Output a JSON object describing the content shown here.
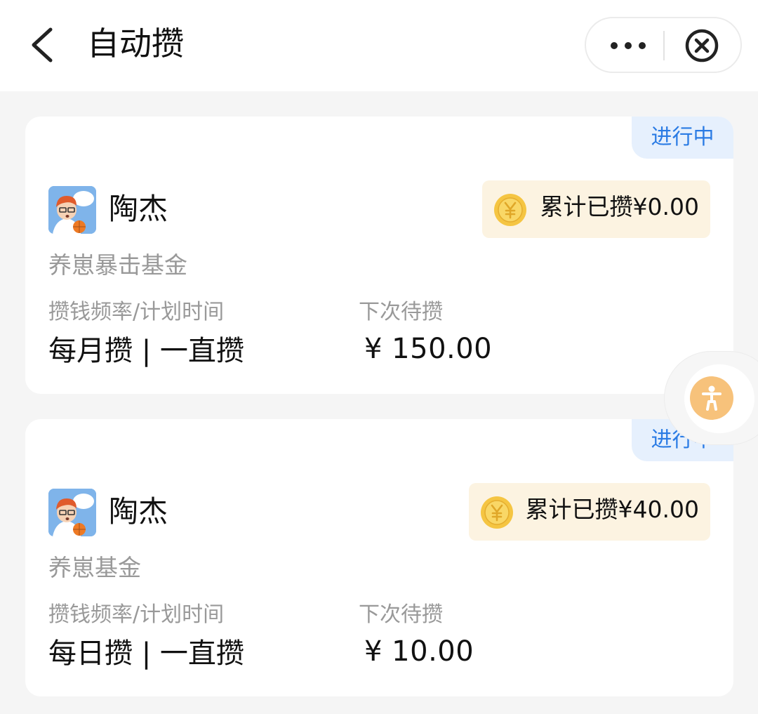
{
  "header": {
    "title": "自动攒",
    "back_icon": "chevron-left-icon",
    "more_icon": "more-dots-icon",
    "close_icon": "circle-close-icon"
  },
  "colors": {
    "status_text": "#2a7be4",
    "status_bg": "#e6f0fd",
    "total_bg": "#fcf3e1",
    "coin": "#f5c542",
    "accessibility_button": "#f7c27b"
  },
  "labels": {
    "frequency": "攒钱频率/计划时间",
    "next_deposit": "下次待攒"
  },
  "plans": [
    {
      "status": "进行中",
      "owner": "陶杰",
      "fund": "养崽暴击基金",
      "total": "累计已攒¥0.00",
      "frequency": "每月攒 | 一直攒",
      "next_amount": "¥ 150.00"
    },
    {
      "status": "进行中",
      "owner": "陶杰",
      "fund": "养崽基金",
      "total": "累计已攒¥40.00",
      "frequency": "每日攒 | 一直攒",
      "next_amount": "¥ 10.00"
    }
  ],
  "floating": {
    "icon": "accessibility-icon"
  }
}
